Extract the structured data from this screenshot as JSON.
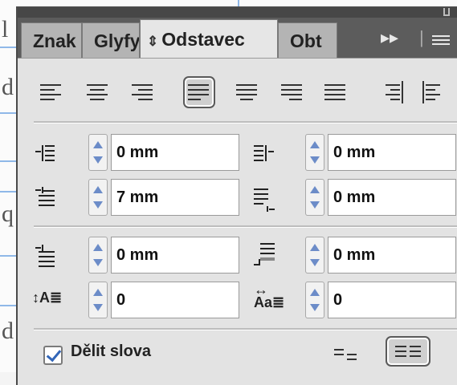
{
  "document": {
    "glyphs": [
      "l",
      "d",
      "q",
      "d"
    ]
  },
  "panel": {
    "tabs": [
      {
        "label": "Znak",
        "active": false
      },
      {
        "label": "Glyfy",
        "active": false
      },
      {
        "label": "Odstavec",
        "active": true,
        "icon": "updown-arrows-icon"
      },
      {
        "label": "Obt",
        "active": false
      }
    ],
    "controls": {
      "expand": "▸▸",
      "divider": "|"
    }
  },
  "alignment": {
    "buttons": [
      "align-left",
      "align-center",
      "align-right",
      "justify-last-left",
      "justify-last-center",
      "justify-last-right",
      "justify-all",
      "align-towards-spine",
      "align-away-from-spine"
    ],
    "active": "justify-last-left"
  },
  "indents": {
    "left_indent": "0 mm",
    "right_indent": "0 mm",
    "first_line_indent": "7 mm",
    "last_line_right_indent": "0 mm"
  },
  "spacing": {
    "space_before": "0 mm",
    "space_after": "0 mm",
    "drop_cap_lines": "0",
    "drop_cap_chars": "0"
  },
  "hyphenation": {
    "label": "Dělit slova",
    "checked": true
  },
  "composer": {
    "active": "paragraph-composer"
  },
  "colors": {
    "accent": "#3266b8",
    "stepper_arrow": "#6c8cc8"
  }
}
